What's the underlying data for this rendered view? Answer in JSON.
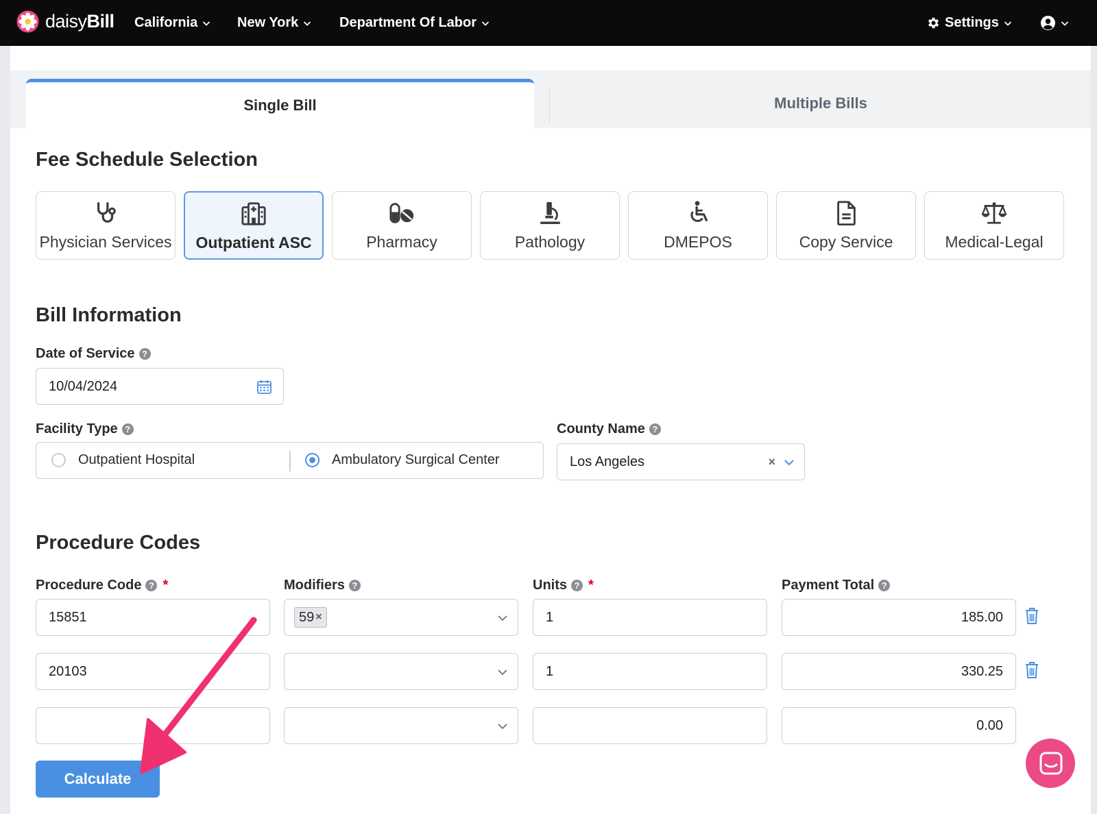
{
  "brand": {
    "name_light": "daisy",
    "name_bold": "Bill"
  },
  "nav": {
    "items": [
      "California",
      "New York",
      "Department Of Labor"
    ],
    "settings_label": "Settings"
  },
  "tabs": {
    "single": "Single Bill",
    "multiple": "Multiple Bills"
  },
  "fee_schedule": {
    "title": "Fee Schedule Selection",
    "options": [
      {
        "label": "Physician Services",
        "icon": "stethoscope-icon",
        "selected": false
      },
      {
        "label": "Outpatient ASC",
        "icon": "hospital-icon",
        "selected": true
      },
      {
        "label": "Pharmacy",
        "icon": "pills-icon",
        "selected": false
      },
      {
        "label": "Pathology",
        "icon": "microscope-icon",
        "selected": false
      },
      {
        "label": "DMEPOS",
        "icon": "wheelchair-icon",
        "selected": false
      },
      {
        "label": "Copy Service",
        "icon": "document-icon",
        "selected": false
      },
      {
        "label": "Medical-Legal",
        "icon": "scales-icon",
        "selected": false
      }
    ]
  },
  "bill_info": {
    "title": "Bill Information",
    "date_label": "Date of Service",
    "date_value": "10/04/2024",
    "facility_label": "Facility Type",
    "facility_options": [
      "Outpatient Hospital",
      "Ambulatory Surgical Center"
    ],
    "facility_selected": "Ambulatory Surgical Center",
    "county_label": "County Name",
    "county_value": "Los Angeles"
  },
  "procedures": {
    "title": "Procedure Codes",
    "headers": {
      "code": "Procedure Code",
      "modifiers": "Modifiers",
      "units": "Units",
      "payment": "Payment Total"
    },
    "required_mark": "*",
    "rows": [
      {
        "code": "15851",
        "modifier": "59",
        "units": "1",
        "payment": "185.00"
      },
      {
        "code": "20103",
        "modifier": "",
        "units": "1",
        "payment": "330.25"
      },
      {
        "code": "",
        "modifier": "",
        "units": "",
        "payment": "0.00"
      }
    ]
  },
  "actions": {
    "calculate": "Calculate"
  },
  "colors": {
    "accent": "#4a90e2",
    "brand_pink": "#ec4a86",
    "annotation_arrow": "#f0306f"
  }
}
